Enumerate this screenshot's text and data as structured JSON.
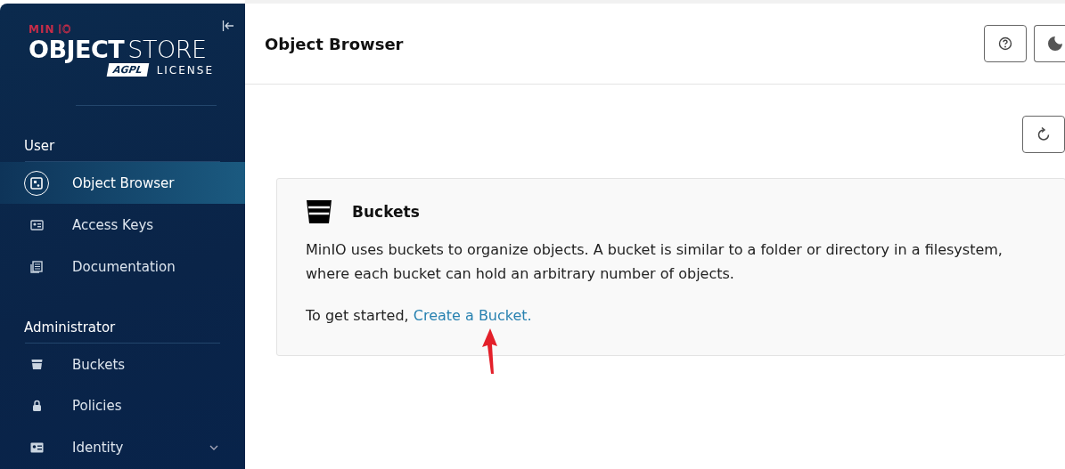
{
  "logo": {
    "brand_red": "MIN",
    "brand_outline": "IO",
    "title_bold": "OBJECT",
    "title_thin": "STORE",
    "badge": "AGPL",
    "license": "LICENSE"
  },
  "sidebar": {
    "sections": [
      {
        "title": "User",
        "items": [
          {
            "label": "Object Browser",
            "selected": true,
            "expandable": false
          },
          {
            "label": "Access Keys",
            "selected": false,
            "expandable": false
          },
          {
            "label": "Documentation",
            "selected": false,
            "expandable": false
          }
        ]
      },
      {
        "title": "Administrator",
        "items": [
          {
            "label": "Buckets",
            "selected": false,
            "expandable": false
          },
          {
            "label": "Policies",
            "selected": false,
            "expandable": false
          },
          {
            "label": "Identity",
            "selected": false,
            "expandable": true
          }
        ]
      }
    ]
  },
  "header": {
    "title": "Object Browser"
  },
  "card": {
    "title": "Buckets",
    "description": "MinIO uses buckets to organize objects. A bucket is similar to a folder or directory in a filesystem, where each bucket can hold an arbitrary number of objects.",
    "prompt": "To get started,",
    "link": "Create a Bucket."
  }
}
